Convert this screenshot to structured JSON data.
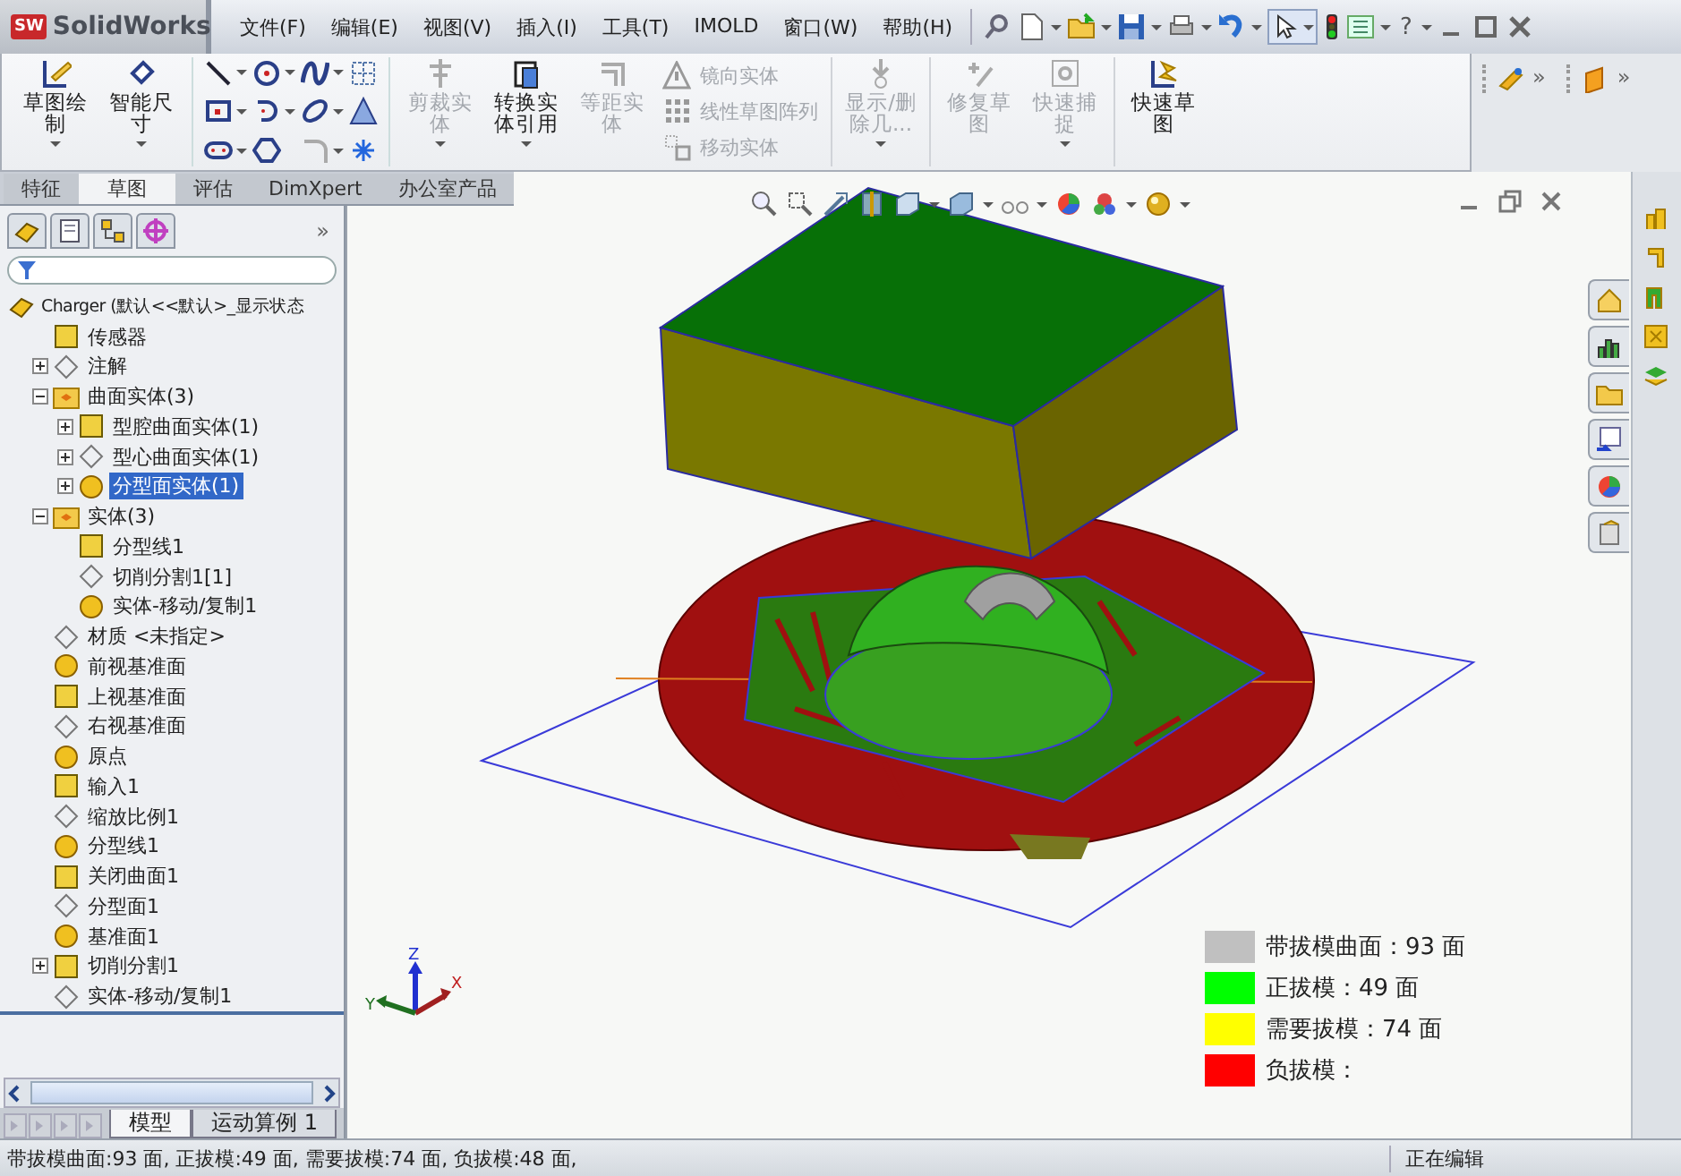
{
  "titlebar": {
    "logo_badge": "SW",
    "logo": "SolidWorks",
    "menus": [
      "文件(F)",
      "编辑(E)",
      "视图(V)",
      "插入(I)",
      "工具(T)",
      "IMOLD",
      "窗口(W)",
      "帮助(H)"
    ],
    "help": "?"
  },
  "ribbon": {
    "commands": [
      {
        "kind": "large",
        "label": "草图绘制",
        "disabled": false,
        "menu": true
      },
      {
        "kind": "large",
        "label": "智能尺寸",
        "disabled": false,
        "menu": true
      },
      {
        "kind": "tools"
      },
      {
        "kind": "large",
        "label": "剪裁实体",
        "disabled": true,
        "menu": true
      },
      {
        "kind": "large",
        "label": "转换实体引用",
        "disabled": false,
        "menu": true
      },
      {
        "kind": "large",
        "label": "等距实体",
        "disabled": true,
        "menu": false
      },
      {
        "kind": "stack",
        "items": [
          {
            "label": "镜向实体",
            "disabled": true
          },
          {
            "label": "线性草图阵列",
            "disabled": true
          },
          {
            "label": "移动实体",
            "disabled": true
          }
        ]
      },
      {
        "kind": "large",
        "label": "显示/删除几...",
        "disabled": true,
        "menu": true
      },
      {
        "kind": "large",
        "label": "修复草图",
        "disabled": true,
        "menu": false
      },
      {
        "kind": "large",
        "label": "快速捕捉",
        "disabled": true,
        "menu": true
      },
      {
        "kind": "large",
        "label": "快速草图",
        "disabled": false,
        "menu": false
      }
    ],
    "chevrons": [
      "»",
      "»"
    ]
  },
  "tabs": [
    {
      "label": "特征",
      "selected": false
    },
    {
      "label": "草图",
      "selected": true
    },
    {
      "label": "评估",
      "selected": false
    },
    {
      "label": "DimXpert",
      "selected": false
    },
    {
      "label": "办公室产品",
      "selected": false
    }
  ],
  "tree": {
    "chevron": "»",
    "items": [
      {
        "label": "Charger (默认<<默认>_显示状态",
        "selected": false,
        "children": [
          {
            "label": "传感器",
            "selected": false
          },
          {
            "label": "注解",
            "selected": false,
            "expanded": false
          },
          {
            "label": "曲面实体(3)",
            "selected": false,
            "expanded": true,
            "children": [
              {
                "label": "型腔曲面实体(1)",
                "selected": false,
                "expanded": false
              },
              {
                "label": "型心曲面实体(1)",
                "selected": false,
                "expanded": false
              },
              {
                "label": "分型面实体(1)",
                "selected": true,
                "expanded": false
              }
            ]
          },
          {
            "label": "实体(3)",
            "selected": false,
            "expanded": true,
            "children": [
              {
                "label": "分型线1",
                "selected": false
              },
              {
                "label": "切削分割1[1]",
                "selected": false
              },
              {
                "label": "实体-移动/复制1",
                "selected": false
              }
            ]
          },
          {
            "label": "材质 <未指定>",
            "selected": false
          },
          {
            "label": "前视基准面",
            "selected": false
          },
          {
            "label": "上视基准面",
            "selected": false
          },
          {
            "label": "右视基准面",
            "selected": false
          },
          {
            "label": "原点",
            "selected": false
          },
          {
            "label": "输入1",
            "selected": false
          },
          {
            "label": "缩放比例1",
            "selected": false
          },
          {
            "label": "分型线1",
            "selected": false
          },
          {
            "label": "关闭曲面1",
            "selected": false
          },
          {
            "label": "分型面1",
            "selected": false
          },
          {
            "label": "基准面1",
            "selected": false
          },
          {
            "label": "切削分割1",
            "selected": false,
            "expanded": false
          },
          {
            "label": "实体-移动/复制1",
            "selected": false
          }
        ]
      }
    ]
  },
  "viewport": {
    "triad": [
      "X",
      "Y",
      "Z"
    ],
    "legend": [
      {
        "label": "带拔模曲面：93 面",
        "color": "#c0c0c0"
      },
      {
        "label": "正拔模：49 面",
        "color": "#00ff00"
      },
      {
        "label": "需要拔模：74 面",
        "color": "#ffff00"
      },
      {
        "label": "负拔模：",
        "color": "#ff0000"
      }
    ]
  },
  "bottom_tabs": [
    {
      "label": "模型",
      "selected": true
    },
    {
      "label": "运动算例 1",
      "selected": false
    }
  ],
  "status_bar": {
    "message": "带拔模曲面:93 面, 正拔模:49 面, 需要拔模:74 面, 负拔模:48 面,",
    "mode": "正在编辑"
  }
}
